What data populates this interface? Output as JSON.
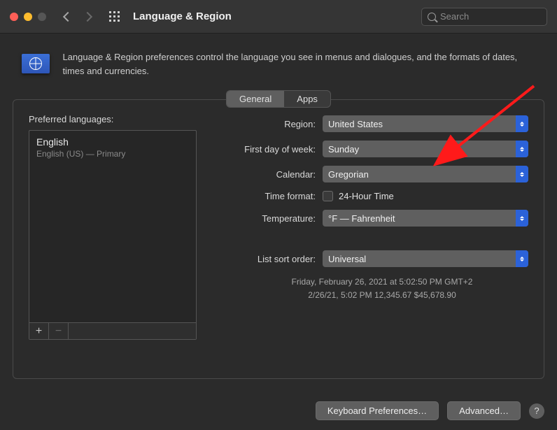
{
  "window": {
    "title": "Language & Region",
    "search_placeholder": "Search"
  },
  "header": {
    "description": "Language & Region preferences control the language you see in menus and dialogues, and the formats of dates, times and currencies."
  },
  "tabs": {
    "general": "General",
    "apps": "Apps",
    "active": "General"
  },
  "preferred_languages": {
    "label": "Preferred languages:",
    "items": [
      {
        "name": "English",
        "subtitle": "English (US) — Primary"
      }
    ]
  },
  "settings": {
    "region": {
      "label": "Region:",
      "value": "United States"
    },
    "first_day": {
      "label": "First day of week:",
      "value": "Sunday"
    },
    "calendar": {
      "label": "Calendar:",
      "value": "Gregorian"
    },
    "time_format": {
      "label": "Time format:",
      "checkbox_label": "24-Hour Time",
      "checked": false
    },
    "temperature": {
      "label": "Temperature:",
      "value": "°F — Fahrenheit"
    },
    "list_sort": {
      "label": "List sort order:",
      "value": "Universal"
    }
  },
  "example": {
    "line1": "Friday, February 26, 2021 at 5:02:50 PM GMT+2",
    "line2": "2/26/21, 5:02 PM    12,345.67    $45,678.90"
  },
  "footer": {
    "keyboard_prefs": "Keyboard Preferences…",
    "advanced": "Advanced…"
  }
}
